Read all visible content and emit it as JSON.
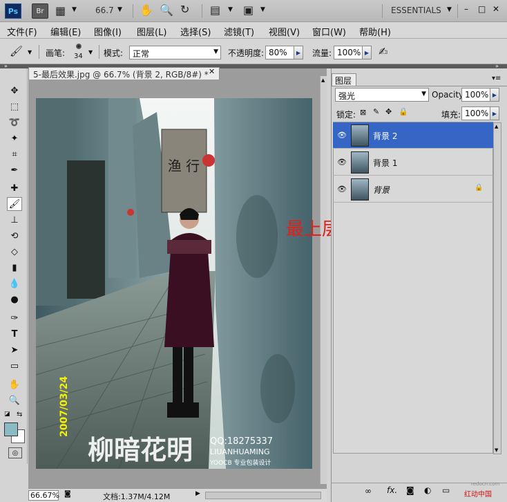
{
  "appbar": {
    "ps_logo": "Ps",
    "br_logo": "Br",
    "zoom": "66.7",
    "workspace": "ESSENTIALS",
    "icons": [
      "screen-mode-icon",
      "hand-icon",
      "zoom-icon",
      "rotate-icon",
      "arrange-icon",
      "screen-icon"
    ]
  },
  "window_controls": {
    "minimize": "–",
    "maximize": "□",
    "close": "✕"
  },
  "menu": [
    "文件(F)",
    "编辑(E)",
    "图像(I)",
    "图层(L)",
    "选择(S)",
    "滤镜(T)",
    "视图(V)",
    "窗口(W)",
    "帮助(H)"
  ],
  "options": {
    "brush_label": "画笔:",
    "brush_size": "34",
    "mode_label": "模式:",
    "mode_value": "正常",
    "opacity_label": "不透明度:",
    "opacity_value": "80%",
    "flow_label": "流量:",
    "flow_value": "100%"
  },
  "document": {
    "tab_title": "5-最后效果.jpg @ 66.7% (背景 2, RGB/8#) *",
    "tab_close": "✕",
    "overlay_text": "最上层改为强光模式",
    "photo": {
      "date_stamp": "2007/03/24",
      "brand_cn": "柳暗花明",
      "qq": "QQ:18275337",
      "brand_en": "LIUANHUAMING",
      "studio": "YOOCB 专业包装设计",
      "sign": "渔 行"
    }
  },
  "status": {
    "zoom": "66.67%",
    "doc_info": "文档:1.37M/4.12M"
  },
  "layers_panel": {
    "tab": "图层",
    "blend_mode": "强光",
    "opacity_label": "Opacity:",
    "opacity_value": "100%",
    "lock_label": "锁定:",
    "fill_label": "填充:",
    "fill_value": "100%",
    "layers": [
      {
        "name": "背景 2",
        "selected": true
      },
      {
        "name": "背景 1",
        "selected": false
      },
      {
        "name": "背景",
        "selected": false,
        "locked": true
      }
    ],
    "footer_icons": [
      "link-icon",
      "fx-icon",
      "mask-icon",
      "adjustment-icon",
      "group-icon",
      "new-layer-icon",
      "trash-icon"
    ]
  },
  "watermark": "红动中国",
  "watermark_url": "redocn.com",
  "colors": {
    "selected": "#3566c6",
    "overlay_red": "#e0201a",
    "panel_bg": "#d4d4d4"
  }
}
